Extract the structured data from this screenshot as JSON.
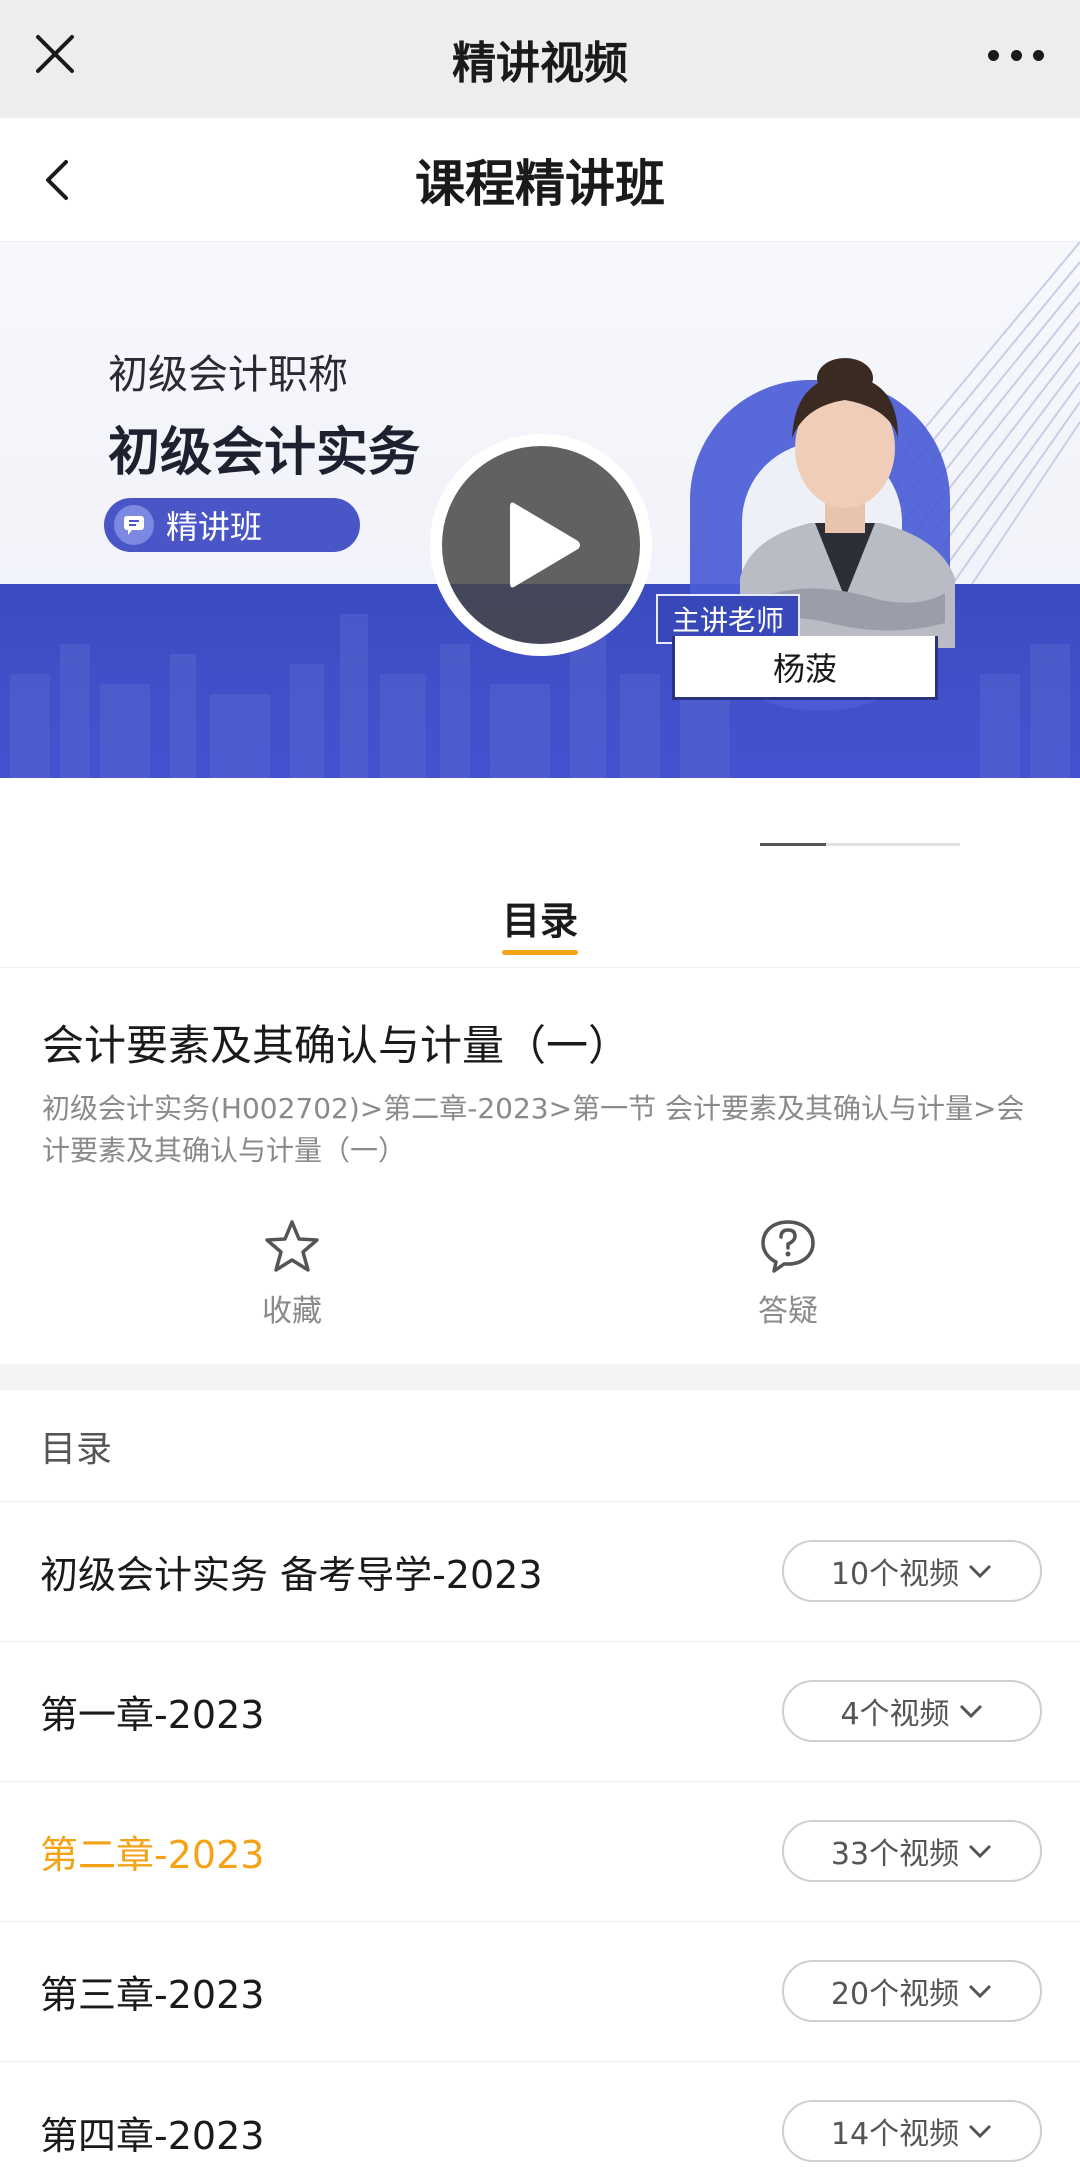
{
  "topbar": {
    "title": "精讲视频"
  },
  "header": {
    "title": "课程精讲班"
  },
  "banner": {
    "category": "初级会计职称",
    "course": "初级会计实务",
    "tag": "精讲班",
    "teacher_role": "主讲老师",
    "teacher_name": "杨菠"
  },
  "tab": {
    "label": "目录"
  },
  "lesson": {
    "title": "会计要素及其确认与计量（一）",
    "path": "初级会计实务(H002702)>第二章-2023>第一节 会计要素及其确认与计量>会计要素及其确认与计量（一）"
  },
  "actions": {
    "favorite": "收藏",
    "qa": "答疑"
  },
  "catalog": {
    "heading": "目录",
    "chapters": [
      {
        "title": "初级会计实务 备考导学-2023",
        "count": "10个视频"
      },
      {
        "title": "第一章-2023",
        "count": "4个视频"
      },
      {
        "title": "第二章-2023",
        "count": "33个视频",
        "active": true
      },
      {
        "title": "第三章-2023",
        "count": "20个视频"
      },
      {
        "title": "第四章-2023",
        "count": "14个视频"
      }
    ]
  },
  "colors": {
    "accent": "#f5a316",
    "banner_blue": "#4150c8"
  }
}
